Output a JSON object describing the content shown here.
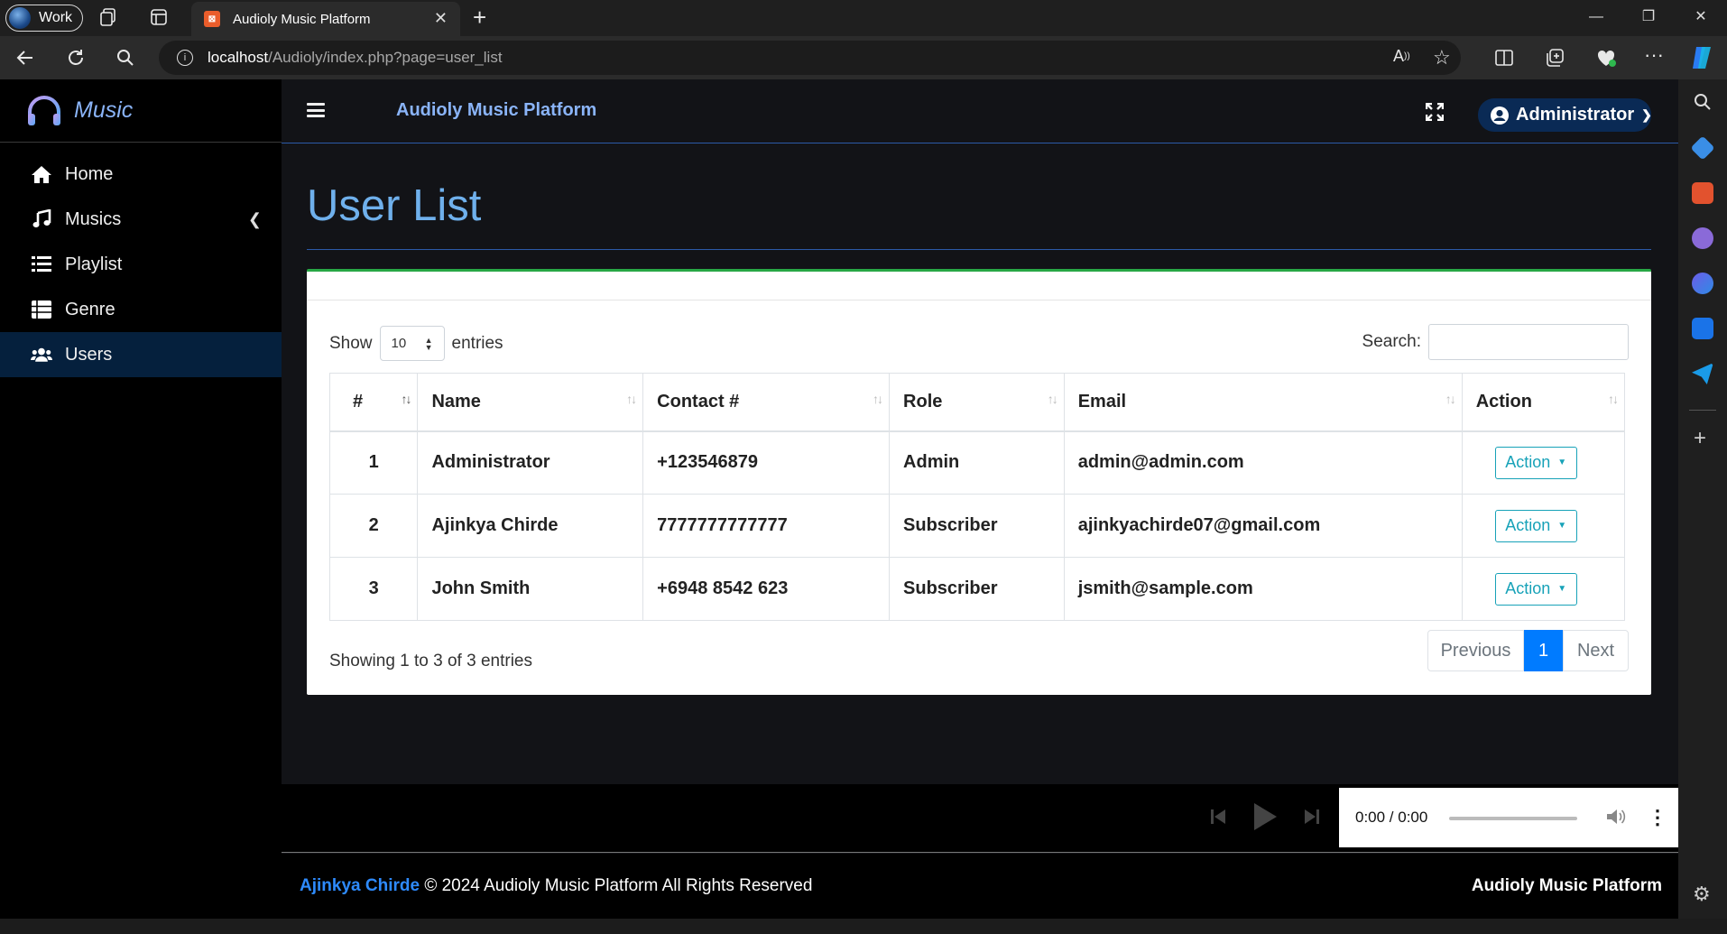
{
  "browser": {
    "profile_label": "Work",
    "tab_title": "Audioly Music Platform",
    "tab_favicon": "XAMPP",
    "url_host": "localhost",
    "url_path": "/Audioly/index.php?page=user_list",
    "icons": [
      "workspaces-icon",
      "tab-actions-icon",
      "back-icon",
      "refresh-icon",
      "search-icon",
      "info-icon",
      "read-aloud-icon",
      "favorite-icon",
      "split-screen-icon",
      "collections-icon",
      "browser-essentials-icon",
      "more-icon",
      "copilot-icon"
    ]
  },
  "sidebar": {
    "brand": "Music",
    "items": [
      {
        "label": "Home",
        "icon": "home-icon"
      },
      {
        "label": "Musics",
        "icon": "music-note-icon"
      },
      {
        "label": "Playlist",
        "icon": "list-icon"
      },
      {
        "label": "Genre",
        "icon": "th-list-icon"
      },
      {
        "label": "Users",
        "icon": "users-icon"
      }
    ]
  },
  "topnav": {
    "title": "Audioly Music Platform",
    "user_label": "Administrator"
  },
  "page": {
    "title": "User List"
  },
  "table_controls": {
    "show_label": "Show",
    "entries_value": "10",
    "entries_label": "entries",
    "search_label": "Search:",
    "search_value": ""
  },
  "table": {
    "headers": [
      "#",
      "Name",
      "Contact #",
      "Role",
      "Email",
      "Action"
    ],
    "rows": [
      {
        "num": "1",
        "name": "Administrator",
        "contact": "+123546879",
        "role": "Admin",
        "email": "admin@admin.com",
        "action": "Action"
      },
      {
        "num": "2",
        "name": "Ajinkya Chirde",
        "contact": "7777777777777",
        "role": "Subscriber",
        "email": "ajinkyachirde07@gmail.com",
        "action": "Action"
      },
      {
        "num": "3",
        "name": "John Smith",
        "contact": "+6948 8542 623",
        "role": "Subscriber",
        "email": "jsmith@sample.com",
        "action": "Action"
      }
    ]
  },
  "pagination": {
    "summary": "Showing 1 to 3 of 3 entries",
    "prev": "Previous",
    "current": "1",
    "next": "Next"
  },
  "player": {
    "time": "0:00 / 0:00"
  },
  "footer": {
    "author": "Ajinkya Chirde",
    "copyright": "© 2024 Audioly Music Platform All Rights Reserved",
    "brand": "Audioly Music Platform"
  },
  "colors": {
    "accent": "#8ab4f8",
    "title": "#6fb0ec",
    "card_top": "#28a745",
    "action": "#17a2b8",
    "page_active": "#007bff",
    "footer_link": "#2e8bff"
  }
}
